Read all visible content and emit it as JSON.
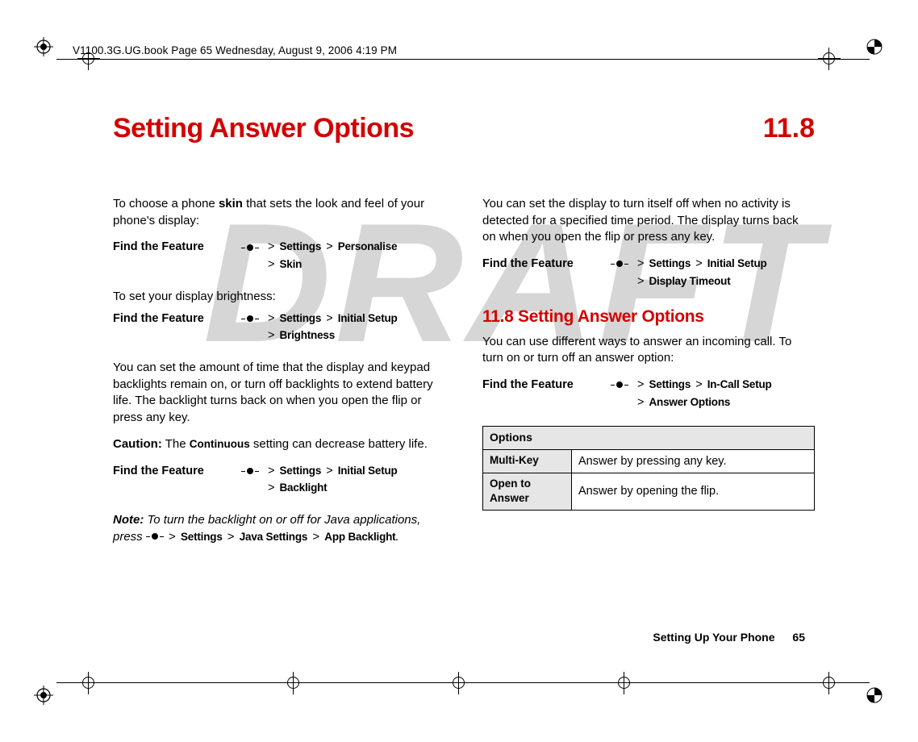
{
  "meta": {
    "header_line": "V1100.3G.UG.book  Page 65  Wednesday, August 9, 2006  4:19 PM",
    "watermark": "DRAFT"
  },
  "title": {
    "text": "Setting Answer Options",
    "number": "11.8"
  },
  "left": {
    "skin_intro_a": "To choose a phone ",
    "skin_bold": "skin",
    "skin_intro_b": " that sets the look and feel of your phone's display:",
    "find_label": "Find the Feature",
    "skin_path_1a": "Settings",
    "skin_path_1b": "Personalise",
    "skin_path_2": "Skin",
    "brightness_intro": "To set your display brightness:",
    "bright_path_1a": "Settings",
    "bright_path_1b": "Initial Setup",
    "bright_path_2": "Brightness",
    "backlight_para": "You can set the amount of time that the display and keypad backlights remain on, or turn off backlights to extend battery life. The backlight turns back on when you open the flip or press any key.",
    "caution_label": "Caution:",
    "caution_a": " The ",
    "caution_cond": "Continuous",
    "caution_b": " setting can decrease battery life.",
    "bl_path_1a": "Settings",
    "bl_path_1b": "Initial Setup",
    "bl_path_2": "Backlight",
    "note_label": "Note:",
    "note_a": " To turn the backlight on or off for Java applications, press ",
    "note_p1": "Settings",
    "note_p2": "Java Settings",
    "note_p3": "App Backlight",
    "note_end": "."
  },
  "right": {
    "timeout_para": "You can set the display to turn itself off when no activity is detected for a specified time period. The display turns back on when you open the flip or press any key.",
    "find_label": "Find the Feature",
    "to_path_1a": "Settings",
    "to_path_1b": "Initial Setup",
    "to_path_2": "Display Timeout",
    "subhead": "11.8 Setting Answer Options",
    "answer_para": "You can use different ways to answer an incoming call. To turn on or turn off an answer option:",
    "ans_path_1a": "Settings",
    "ans_path_1b": "In-Call Setup",
    "ans_path_2": "Answer Options",
    "table": {
      "header": "Options",
      "rows": [
        {
          "key": "Multi-Key",
          "desc": "Answer by pressing any key."
        },
        {
          "key": "Open to Answer",
          "desc": "Answer by opening the flip."
        }
      ]
    }
  },
  "footer": {
    "section": "Setting Up Your Phone",
    "page": "65"
  }
}
